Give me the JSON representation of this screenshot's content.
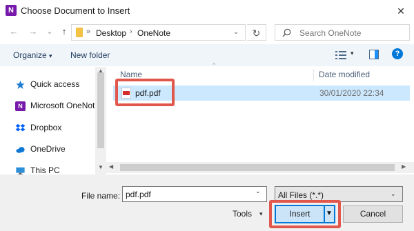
{
  "window": {
    "title": "Choose Document to Insert",
    "app_icon_letter": "N",
    "close_glyph": "✕",
    "app_icon_color": "#7719aa"
  },
  "navigation": {
    "back_glyph": "←",
    "forward_glyph": "→",
    "history_glyph": "⌄",
    "up_glyph": "↑",
    "breadcrumb_separator": "»",
    "breadcrumb": [
      "Desktop",
      "OneNote"
    ],
    "breadcrumb_arrow": "›",
    "address_dropdown_glyph": "⌄",
    "refresh_glyph": "↻"
  },
  "search": {
    "placeholder": "Search OneNote"
  },
  "toolbar": {
    "organize_label": "Organize",
    "organize_caret": "▾",
    "new_folder_label": "New folder",
    "view_caret": "▾",
    "help_glyph": "?"
  },
  "sidebar": {
    "items": [
      {
        "label": "Quick access",
        "icon": "star-icon"
      },
      {
        "label": "Microsoft OneNot",
        "icon": "onenote-icon"
      },
      {
        "label": "Dropbox",
        "icon": "dropbox-icon"
      },
      {
        "label": "OneDrive",
        "icon": "cloud-icon"
      },
      {
        "label": "This PC",
        "icon": "computer-icon"
      }
    ]
  },
  "file_list": {
    "columns": {
      "name": "Name",
      "date_modified": "Date modified"
    },
    "sort_glyph": "^",
    "rows": [
      {
        "name": "pdf.pdf",
        "date_modified": "30/01/2020 22:34",
        "selected": true,
        "icon": "pdf-icon"
      }
    ]
  },
  "scrollbars": {
    "up": "▲",
    "down": "▼",
    "left": "◀",
    "right": "▶"
  },
  "footer": {
    "file_name_label": "File name:",
    "file_name_value": "pdf.pdf",
    "file_name_dropdown_glyph": "⌄",
    "file_type_filter": "All Files (*.*)",
    "file_type_dropdown_glyph": "⌄",
    "tools_label": "Tools",
    "tools_caret": "▾",
    "insert_label": "Insert",
    "insert_split_glyph": "▼",
    "cancel_label": "Cancel"
  },
  "colors": {
    "selection": "#cce8ff",
    "highlight_annotation": "#e2574c",
    "primary_button_border": "#0078d7",
    "help_icon": "#0078d7"
  }
}
